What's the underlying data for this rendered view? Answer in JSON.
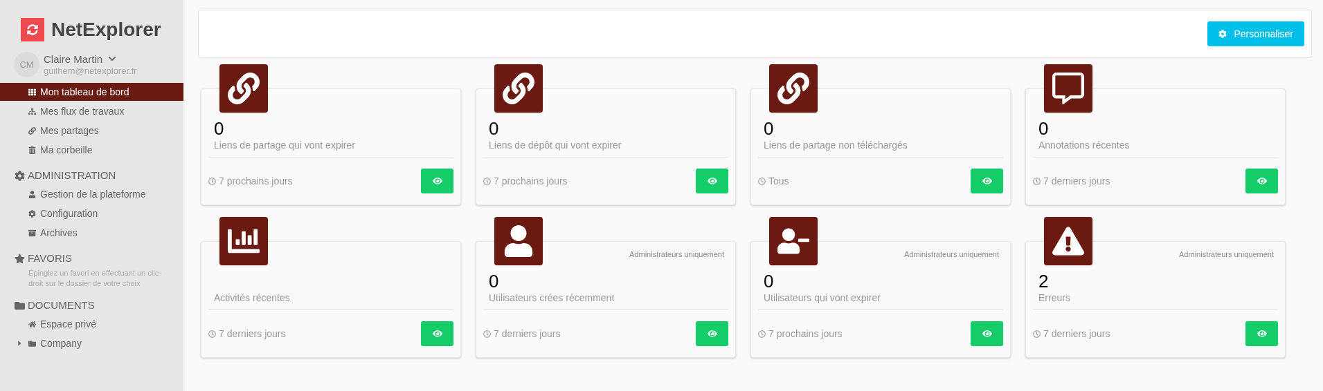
{
  "brand": {
    "name": "NetExplorer"
  },
  "user": {
    "initials": "CM",
    "name": "Claire Martin",
    "email": "guilhem@netexplorer.fr"
  },
  "sidebar": {
    "items": [
      {
        "kind": "grid",
        "label": "Mon tableau de bord",
        "selected": true
      },
      {
        "kind": "sitemap",
        "label": "Mes flux de travaux",
        "selected": false
      },
      {
        "kind": "link",
        "label": "Mes partages",
        "selected": false
      },
      {
        "kind": "trash",
        "label": "Ma corbeille",
        "selected": false
      }
    ],
    "sections": [
      {
        "kind": "gear",
        "title": "ADMINISTRATION",
        "items": [
          {
            "kind": "user",
            "label": "Gestion de la plateforme",
            "selected": false
          },
          {
            "kind": "gear",
            "label": "Configuration",
            "selected": false
          },
          {
            "kind": "archive",
            "label": "Archives",
            "selected": false
          }
        ]
      },
      {
        "kind": "star",
        "title": "FAVORIS",
        "hint": "Épinglez un favori en effectuant un clic-droit sur le dossier de votre choix"
      },
      {
        "kind": "folder",
        "title": "DOCUMENTS",
        "items": [
          {
            "kind": "home",
            "label": "Espace privé",
            "selected": false
          },
          {
            "kind": "folder",
            "label": "Company",
            "selected": false,
            "expanded": false
          }
        ]
      }
    ]
  },
  "toolbar": {
    "button": "Personnaliser"
  },
  "cards": [
    {
      "kind": "link",
      "count": "0",
      "label": "Liens de partage qui vont expirer",
      "period": "7 prochains jours"
    },
    {
      "kind": "link",
      "count": "0",
      "label": "Liens de dépôt qui vont expirer",
      "period": "7 prochains jours"
    },
    {
      "kind": "link",
      "count": "0",
      "label": "Liens de partage non téléchargés",
      "period": "Tous"
    },
    {
      "kind": "comment",
      "count": "0",
      "label": "Annotations récentes",
      "period": "7 derniers jours"
    },
    {
      "kind": "chart",
      "label": "Activités récentes",
      "period": "7 derniers jours"
    },
    {
      "kind": "user",
      "note": "Administrateurs uniquement",
      "count": "0",
      "label": "Utilisateurs crées récemment",
      "period": "7 derniers jours"
    },
    {
      "kind": "user-minus",
      "note": "Administrateurs uniquement",
      "count": "0",
      "label": "Utilisateurs qui vont expirer",
      "period": "7 prochains jours"
    },
    {
      "kind": "warning",
      "note": "Administrateurs uniquement",
      "count": "2",
      "label": "Erreurs",
      "period": "7 derniers jours"
    }
  ]
}
